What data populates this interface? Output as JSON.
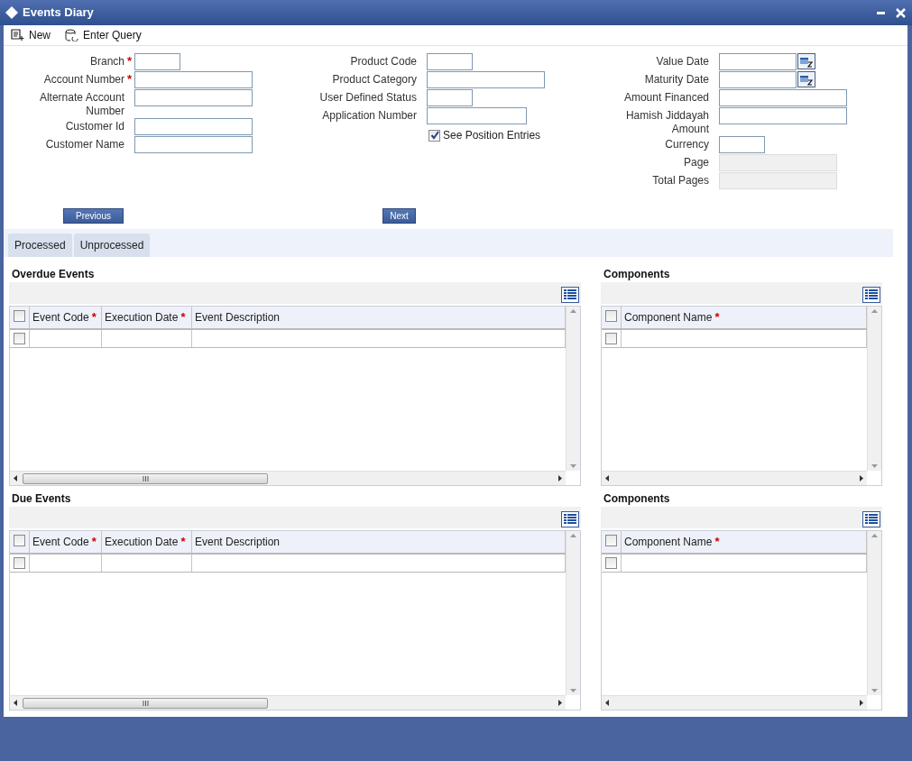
{
  "window": {
    "title": "Events Diary"
  },
  "toolbar": [
    {
      "label": "New",
      "kind": "new"
    },
    {
      "label": "Enter Query",
      "kind": "query"
    }
  ],
  "form": {
    "columns": [
      [
        {
          "label": "Branch",
          "marker": "*",
          "kind": "short"
        },
        {
          "label": "Account Number",
          "marker": "*",
          "kind": "text"
        },
        {
          "label": "Alternate Account Number",
          "kind": "text"
        },
        {
          "label": "Customer Id",
          "kind": "text"
        },
        {
          "label": "Customer Name",
          "kind": "text"
        }
      ],
      [
        {
          "label": "Product Code",
          "kind": "short"
        },
        {
          "label": "Product Category",
          "kind": "text"
        },
        {
          "label": "User Defined Status",
          "kind": "short"
        },
        {
          "label": "Application Number",
          "kind": "medium"
        }
      ],
      [
        {
          "label": "Value Date",
          "kind": "date"
        },
        {
          "label": "Maturity Date",
          "kind": "date"
        },
        {
          "label": "Amount Financed",
          "kind": "wide"
        },
        {
          "label": "Hamish Jiddayah Amount",
          "kind": "wide"
        },
        {
          "label": "Currency",
          "kind": "short"
        },
        {
          "label": "Page",
          "kind": "readonly"
        },
        {
          "label": "Total Pages",
          "kind": "readonly"
        }
      ]
    ],
    "checkbox": {
      "label": "See Position Entries",
      "checked": true
    }
  },
  "nav_buttons": [
    "Previous",
    "Next"
  ],
  "tabs": [
    {
      "label": "Processed"
    },
    {
      "label": "Unprocessed"
    }
  ],
  "sections": [
    {
      "events": {
        "title": "Overdue Events",
        "columns": [
          {
            "label": "Event Code",
            "marker": "*"
          },
          {
            "label": "Execution Date",
            "marker": "*"
          },
          {
            "label": "Event Description"
          }
        ],
        "rows": [
          {
            "checked": false
          }
        ],
        "header_checked": false
      },
      "components": {
        "title": "Components",
        "columns": [
          {
            "label": "Component Name",
            "marker": "*"
          }
        ],
        "rows": [
          {
            "checked": false
          }
        ],
        "header_checked": false
      }
    },
    {
      "events": {
        "title": "Due Events",
        "columns": [
          {
            "label": "Event Code",
            "marker": "*"
          },
          {
            "label": "Execution Date",
            "marker": "*"
          },
          {
            "label": "Event Description"
          }
        ],
        "rows": [
          {
            "checked": false
          }
        ],
        "header_checked": false
      },
      "components": {
        "title": "Components",
        "columns": [
          {
            "label": "Component Name",
            "marker": "*"
          }
        ],
        "rows": [
          {
            "checked": false
          }
        ],
        "header_checked": false
      }
    }
  ]
}
